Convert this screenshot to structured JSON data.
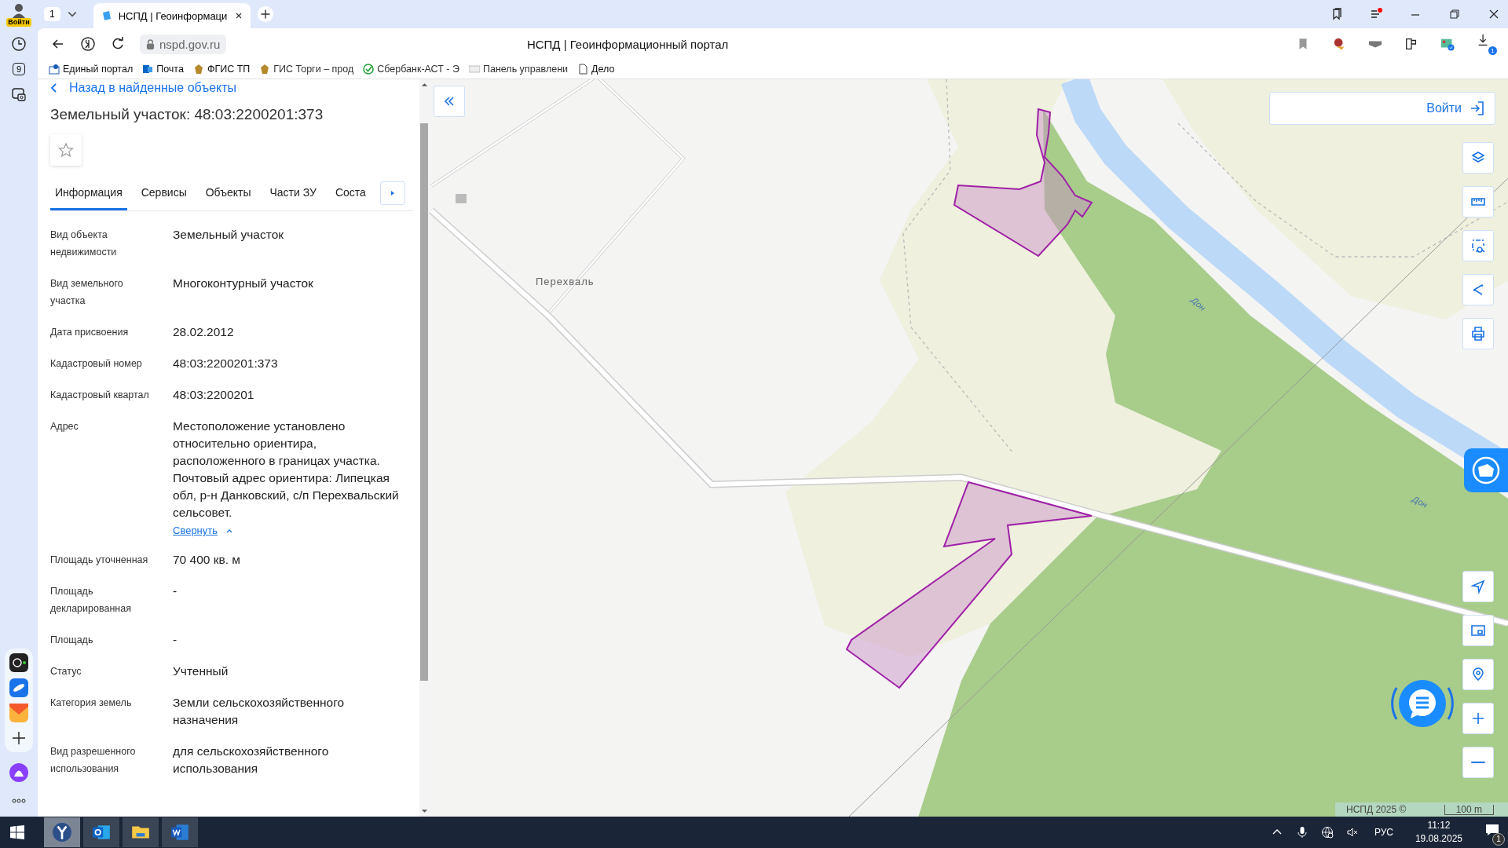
{
  "browser": {
    "profile_badge": "Войти",
    "tab_counter": "1",
    "sidebar_badge": "9",
    "address": "nspd.gov.ru",
    "page_title": "НСПД | Геоинформационный портал",
    "download_badge": "1",
    "tabs": [
      {
        "title": "НСПД | Геоинформаци",
        "selected": true
      }
    ],
    "bookmarks": [
      {
        "label": "Единый портал",
        "kind": "site"
      },
      {
        "label": "Почта",
        "kind": "mail"
      },
      {
        "label": "ФГИС ТП",
        "kind": "emblem"
      },
      {
        "label": "ГИС Торги – прод",
        "kind": "emblem"
      },
      {
        "label": "Сбербанк-АСТ - Э",
        "kind": "check"
      },
      {
        "label": "Панель управлени",
        "kind": "fin"
      },
      {
        "label": "Дело",
        "kind": "document"
      }
    ]
  },
  "panel": {
    "back_link": "Назад в найденные объекты",
    "title": "Земельный участок: 48:03:2200201:373",
    "favorite": false,
    "tabs": [
      {
        "label": "Информация",
        "selected": true
      },
      {
        "label": "Сервисы",
        "selected": false
      },
      {
        "label": "Объекты",
        "selected": false
      },
      {
        "label": "Части ЗУ",
        "selected": false
      },
      {
        "label": "Соста",
        "selected": false
      }
    ],
    "fields": [
      {
        "label": "Вид объекта недвижимости",
        "value": "Земельный участок"
      },
      {
        "label": "Вид земельного участка",
        "value": "Многоконтурный участок"
      },
      {
        "label": "Дата присвоения",
        "value": "28.02.2012"
      },
      {
        "label": "Кадастровый номер",
        "value": "48:03:2200201:373"
      },
      {
        "label": "Кадастровый квартал",
        "value": "48:03:2200201"
      },
      {
        "label": "Адрес",
        "value": "Местоположение установлено относительно ориентира, расположенного в границах участка. Почтовый адрес ориентира: Липецкая обл, р-н Данковский, с/п Перехвальский сельсовет.",
        "link": "Свернуть"
      },
      {
        "label": "Площадь уточненная",
        "value": "70 400 кв. м"
      },
      {
        "label": "Площадь декларированная",
        "value": "-"
      },
      {
        "label": "Площадь",
        "value": "-"
      },
      {
        "label": "Статус",
        "value": "Учтенный"
      },
      {
        "label": "Категория земель",
        "value": "Земли сельскохозяйственного назначения"
      },
      {
        "label": "Вид разрешенного использования",
        "value": "для сельскохозяйственного использования"
      }
    ]
  },
  "map": {
    "login_button": "Войти",
    "labels": [
      "Перехваль",
      "Дон",
      "Дон"
    ],
    "attribution": "НСПД 2025 ©",
    "scale": "100 m"
  },
  "taskbar": {
    "apps": [
      {
        "kind": "browser",
        "selected": true
      },
      {
        "kind": "mail",
        "selected": false
      },
      {
        "kind": "folder",
        "selected": false
      },
      {
        "kind": "word",
        "selected": false
      }
    ],
    "language": "РУС",
    "time": "11:12",
    "date": "19.08.2025",
    "notification_count": "1"
  }
}
